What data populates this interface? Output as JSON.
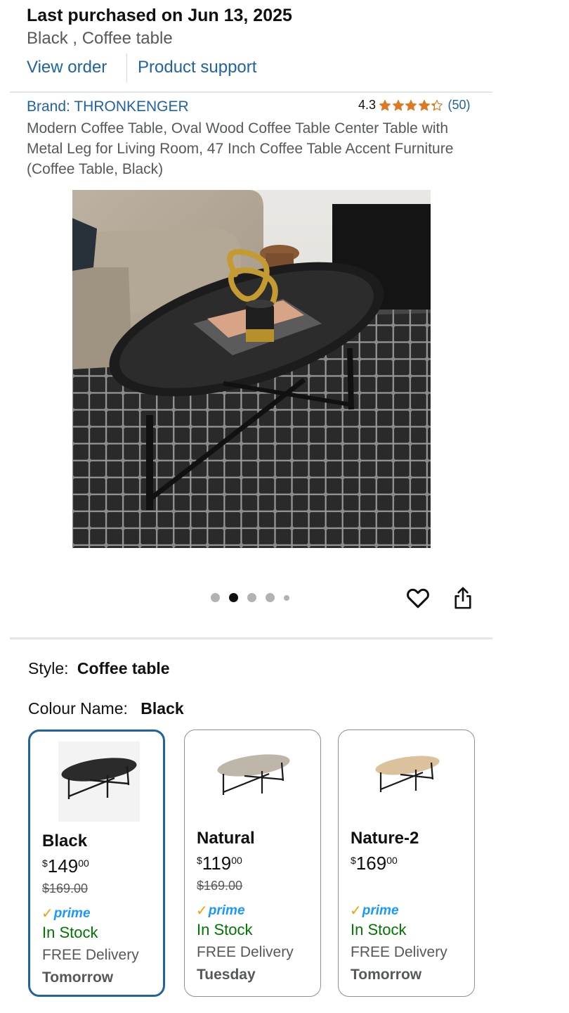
{
  "purchase": {
    "title": "Last purchased on Jun 13, 2025",
    "subtitle": "Black , Coffee table",
    "view_order": "View order",
    "product_support": "Product support"
  },
  "product": {
    "brand": "Brand: THRONKENGER",
    "rating": "4.3",
    "rating_value": 4.3,
    "review_count": "(50)",
    "description": "Modern Coffee Table, Oval Wood Coffee Table Center Table with Metal Leg for Living Room, 47 Inch Coffee Table Accent Furniture (Coffee Table, Black)"
  },
  "gallery": {
    "image_count": 5,
    "active_index": 1
  },
  "options": {
    "style_label": "Style:",
    "style_value": "Coffee table",
    "colour_label": "Colour Name:",
    "colour_value": "Black"
  },
  "swatches": [
    {
      "name": "Black",
      "currency": "$",
      "price_whole": "149",
      "price_fraction": "00",
      "list_price": "$169.00",
      "prime": "prime",
      "stock": "In Stock",
      "delivery": "FREE Delivery",
      "delivery_day": "Tomorrow",
      "selected": true,
      "top_color": "#2b2b2b"
    },
    {
      "name": "Natural",
      "currency": "$",
      "price_whole": "119",
      "price_fraction": "00",
      "list_price": "$169.00",
      "prime": "prime",
      "stock": "In Stock",
      "delivery": "FREE Delivery",
      "delivery_day": "Tuesday",
      "selected": false,
      "top_color": "#bfb6aa"
    },
    {
      "name": "Nature-2",
      "currency": "$",
      "price_whole": "169",
      "price_fraction": "00",
      "list_price": "",
      "prime": "prime",
      "stock": "In Stock",
      "delivery": "FREE Delivery",
      "delivery_day": "Tomorrow",
      "selected": false,
      "top_color": "#dcc29c"
    }
  ],
  "colors": {
    "link": "#2162a1",
    "star": "#de7921",
    "prime_blue": "#1a98ff",
    "prime_check": "#ff9900",
    "in_stock": "#007600",
    "selected_border": "#2162a1"
  }
}
